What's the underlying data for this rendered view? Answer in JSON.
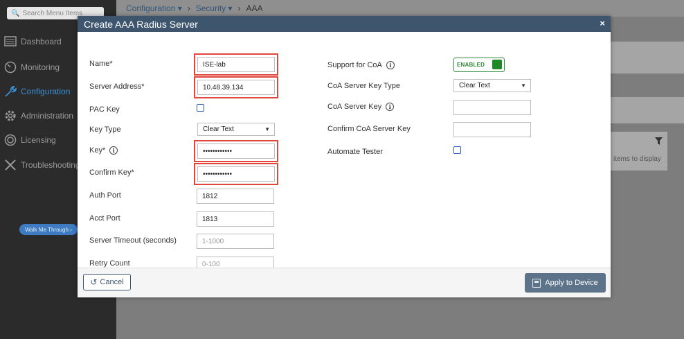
{
  "sidebar": {
    "search_placeholder": "Search Menu Items",
    "items": [
      {
        "label": "Dashboard",
        "icon": "dashboard-icon"
      },
      {
        "label": "Monitoring",
        "icon": "monitoring-icon"
      },
      {
        "label": "Configuration",
        "icon": "wrench-icon",
        "active": true
      },
      {
        "label": "Administration",
        "icon": "gear-icon"
      },
      {
        "label": "Licensing",
        "icon": "licensing-icon"
      },
      {
        "label": "Troubleshooting",
        "icon": "tools-icon"
      }
    ],
    "walk_me_label": "Walk Me Through ›"
  },
  "breadcrumb": {
    "items": [
      "Configuration",
      "Security",
      "AAA"
    ]
  },
  "background": {
    "empty_text": "items to display"
  },
  "modal": {
    "title": "Create AAA Radius Server",
    "close_label": "×",
    "left_fields": {
      "name_label": "Name*",
      "name_value": "ISE-lab",
      "server_address_label": "Server Address*",
      "server_address_value": "10.48.39.134",
      "pac_key_label": "PAC Key",
      "key_type_label": "Key Type",
      "key_type_value": "Clear Text",
      "key_label": "Key*",
      "key_value": "••••••••••••",
      "confirm_key_label": "Confirm Key*",
      "confirm_key_value": "••••••••••••",
      "auth_port_label": "Auth Port",
      "auth_port_value": "1812",
      "acct_port_label": "Acct Port",
      "acct_port_value": "1813",
      "server_timeout_label": "Server Timeout (seconds)",
      "server_timeout_placeholder": "1-1000",
      "retry_count_label": "Retry Count",
      "retry_count_placeholder": "0-100"
    },
    "right_fields": {
      "support_coa_label": "Support for CoA",
      "support_coa_toggle": "ENABLED",
      "coa_key_type_label": "CoA Server Key Type",
      "coa_key_type_value": "Clear Text",
      "coa_key_label": "CoA Server Key",
      "confirm_coa_key_label": "Confirm CoA Server Key",
      "automate_tester_label": "Automate Tester"
    },
    "footer": {
      "cancel_label": "Cancel",
      "apply_label": "Apply to Device"
    }
  },
  "colors": {
    "header": "#3e556e",
    "highlight": "#e0463c",
    "toggle_green": "#1d8a27"
  }
}
